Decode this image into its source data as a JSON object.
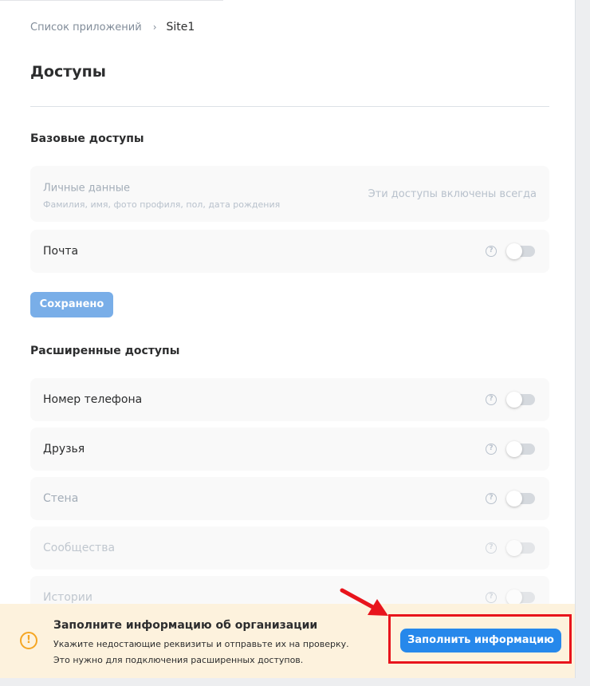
{
  "breadcrumb": {
    "parent": "Список приложений",
    "separator": "›",
    "current": "Site1"
  },
  "page_title": "Доступы",
  "basic": {
    "heading": "Базовые доступы",
    "personal": {
      "label": "Личные данные",
      "sub": "Фамилия, имя, фото профиля, пол, дата рождения",
      "note": "Эти доступы включены всегда"
    },
    "mail": {
      "label": "Почта",
      "enabled": false
    },
    "saved_button": "Сохранено"
  },
  "extended": {
    "heading": "Расширенные доступы",
    "items": [
      {
        "label": "Номер телефона",
        "enabled": false
      },
      {
        "label": "Друзья",
        "enabled": false
      },
      {
        "label": "Стена",
        "enabled": false
      },
      {
        "label": "Сообщества",
        "enabled": false
      },
      {
        "label": "Истории",
        "enabled": false
      }
    ]
  },
  "help_glyph": "?",
  "banner": {
    "icon": "warning-icon",
    "icon_glyph": "!",
    "title": "Заполните информацию об организации",
    "line1": "Укажите недостающие реквизиты и отправьте их на проверку.",
    "line2": "Это нужно для подключения расширенных доступов.",
    "button": "Заполнить информацию"
  },
  "colors": {
    "accent": "#2688eb",
    "saved_button": "#79aee8",
    "banner_bg": "#fdf2dd",
    "warning": "#f5a623",
    "highlight": "#e8141c"
  }
}
